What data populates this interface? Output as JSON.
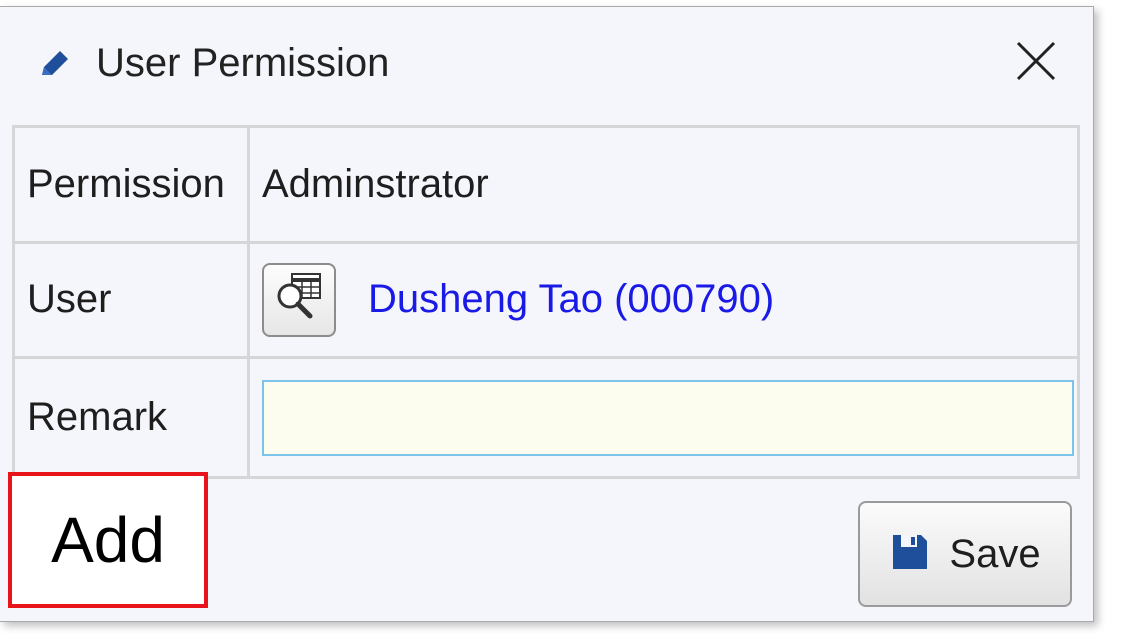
{
  "dialog": {
    "title": "User Permission",
    "title_icon": "pencil-icon",
    "close_icon": "close-icon"
  },
  "form": {
    "rows": [
      {
        "label": "Permission",
        "value": "Adminstrator"
      },
      {
        "label": "User",
        "value": "Dusheng Tao (000790)",
        "lookup_icon": "table-search-icon"
      },
      {
        "label": "Remark",
        "value": "",
        "placeholder": ""
      }
    ]
  },
  "annotation": {
    "label": "Add",
    "border_color": "#e8141c"
  },
  "footer": {
    "save_label": "Save",
    "save_icon": "floppy-disk-icon"
  },
  "colors": {
    "link": "#1a1ae6",
    "accent_icon": "#1f4e9a",
    "input_background": "#fdfdef",
    "input_border": "#7cc3ea"
  }
}
